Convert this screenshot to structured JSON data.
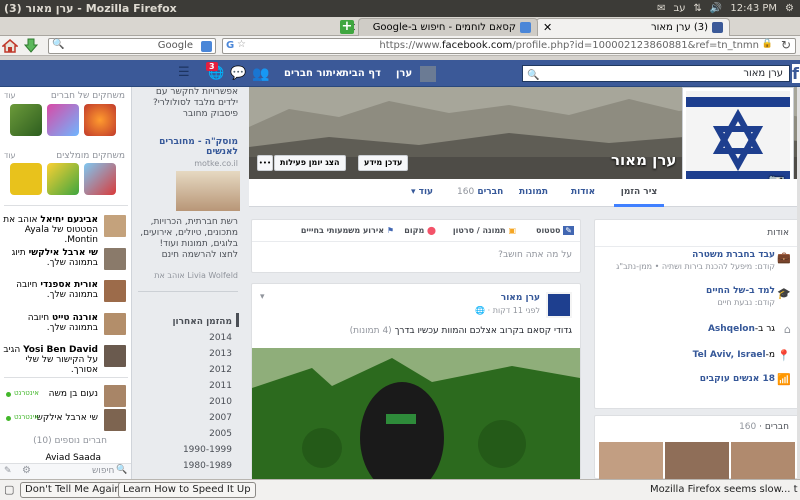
{
  "os": {
    "window_title": "(3) ערן מאור - Mozilla Firefox",
    "lang": "עב",
    "time": "12:43 PM"
  },
  "tabs": [
    {
      "label": "(3) ערן מאור"
    },
    {
      "label": "קסאם לוחמים - חיפוש ב-Google"
    }
  ],
  "nav": {
    "search_placeholder": "Google",
    "url_prefix": "https://www.",
    "url_domain": "facebook.com",
    "url_rest": "/profile.php?id=100002123860881&ref=tn_tnmn"
  },
  "fb_header": {
    "search_value": "ערן מאור",
    "user_name": "ערן",
    "home": "דף הבית",
    "find_friends": "איתור חברים",
    "notif_count": "3"
  },
  "profile": {
    "name": "ערן מאור",
    "update_info": "עדכן מידע",
    "activity_log": "הצג יומן פעילות",
    "more_dots": "•••",
    "tabs": {
      "timeline": "ציר הזמן",
      "about": "אודות",
      "photos": "תמונות",
      "friends": "חברים",
      "friends_count": "160",
      "more": "עוד"
    }
  },
  "about": {
    "header": "אודות",
    "job_title": "עבד בחברת משטרה",
    "job_sub": "קודם: מיפעל להכנת בירות ושתיה • ממן-נתב\"ג",
    "school_title": "למד ב-של החיים",
    "school_sub": "קודם: נבעת חיים",
    "lived": "Ashqelon",
    "lived_prefix": "גר ב-",
    "from": "Tel Aviv, Israel",
    "from_prefix": "מ-",
    "followers": "18 אנשים עוקבים"
  },
  "friends_box": {
    "header": "חברים",
    "count": "160"
  },
  "composer": {
    "status": "סטטוס",
    "photo": "תמונה / סרטון",
    "place": "מקום",
    "life_event": "אירוע משמעותי בחייים",
    "placeholder": "על מה אתה חושב?"
  },
  "post": {
    "author": "ערן מאור",
    "time": "לפני 11 דקות",
    "text": "גדודי קסאם בקרוב אצלכם והמוות עכשיו בדרך",
    "photos": "(4 תמונות)"
  },
  "ads": {
    "ad1_text": "אפשרויות לחקשר עם ילדים מלבד לסולולרי? פיסבוק מחובר",
    "ad2_title": "מוסק\"ה - מחוברים לאנשים",
    "ad2_domain": "motke.co.il",
    "ad2_body": "רשת חברתית, הכרויות, מתכונים, טיולים, אירועים, בלוגים, תמונות ועוד! לחצו להרשמה חינם",
    "ad2_like": "Livia Wolfeld",
    "ad2_like_suffix": "אוהב את"
  },
  "timeline_years": {
    "header": "מהזמן האחרון",
    "years": [
      "2014",
      "2013",
      "2012",
      "2011",
      "2010",
      "2007",
      "2005",
      "1990-1999",
      "1980-1989"
    ]
  },
  "games": {
    "section1": "משחקים של חברים",
    "section2": "משחקים מומלצים",
    "more": "עוד"
  },
  "ticker": [
    {
      "name": "אביגעם יחיאל",
      "text": "אוהב את הסטטוס של Ayala Montin."
    },
    {
      "name": "שי ארבל אילקשי",
      "text": "תיוג בתמונה שלך."
    },
    {
      "name": "אורית אספנדי",
      "text": "חיובה בתמונה שלך."
    },
    {
      "name": "אורנה טייט",
      "text": "חיובה בתמונה שלך."
    },
    {
      "name": "Yosi Ben David",
      "text": "הגיב על הקישור של שלי אסורך."
    }
  ],
  "chat": {
    "online_label": "אינטרנט",
    "contacts": [
      {
        "name": "נעום בן משה"
      },
      {
        "name": "שי ארבל אילקשי"
      }
    ],
    "more_friends": "חברים נוספים (10)",
    "last": "Aviad Saada",
    "search_ph": "חיפוש"
  },
  "notification": {
    "dont_tell": "Don't Tell Me Again",
    "learn": "Learn How to Speed It Up",
    "message": "Mozilla Firefox seems slow... to..."
  }
}
